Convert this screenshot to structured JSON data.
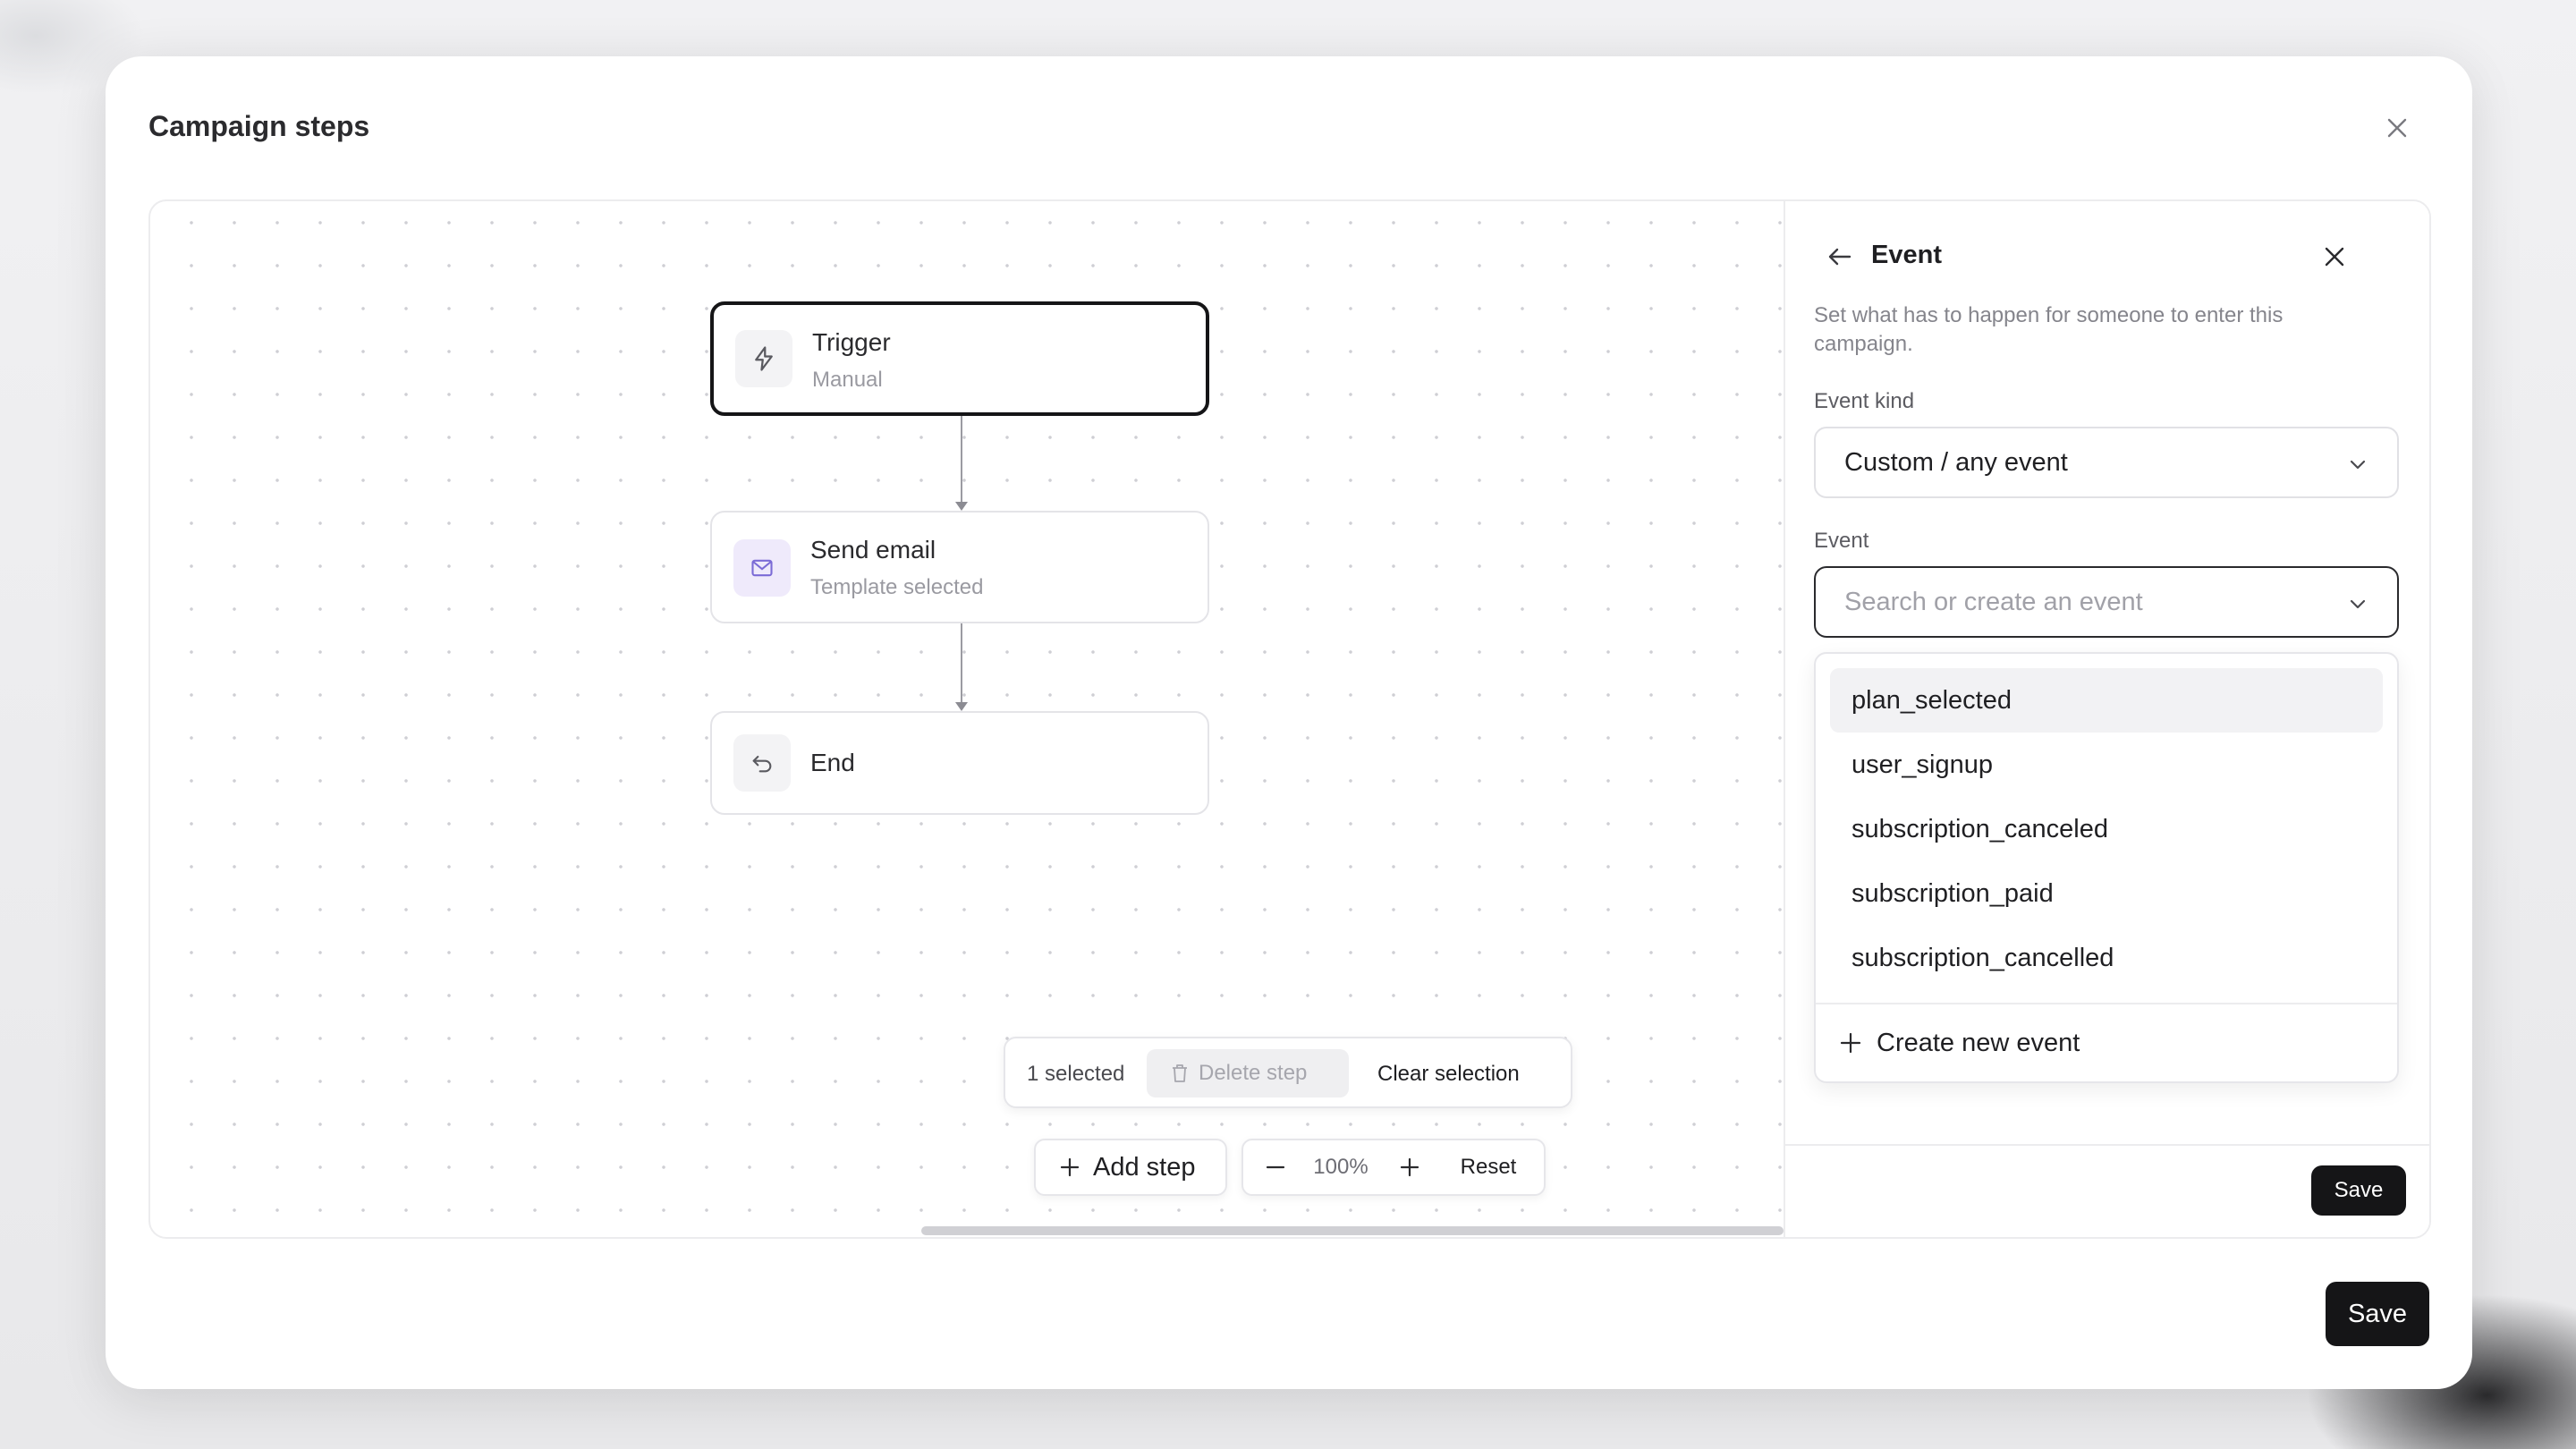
{
  "modal": {
    "title": "Campaign steps",
    "save_label": "Save"
  },
  "nodes": [
    {
      "title": "Trigger",
      "subtitle": "Manual",
      "icon": "lightning-icon",
      "selected": true
    },
    {
      "title": "Send email",
      "subtitle": "Template selected",
      "icon": "mail-icon",
      "selected": false
    },
    {
      "title": "End",
      "subtitle": "",
      "icon": "return-icon",
      "selected": false
    }
  ],
  "selection_bar": {
    "count_label": "1 selected",
    "delete_label": "Delete step",
    "clear_label": "Clear selection"
  },
  "toolbar": {
    "add_step_label": "Add step",
    "zoom_value": "100%",
    "reset_label": "Reset"
  },
  "panel": {
    "title": "Event",
    "description": "Set what has to happen for someone to enter this campaign.",
    "event_kind": {
      "label": "Event kind",
      "value": "Custom / any event"
    },
    "event": {
      "label": "Event",
      "placeholder": "Search or create an event",
      "options": [
        "plan_selected",
        "user_signup",
        "subscription_canceled",
        "subscription_paid",
        "subscription_cancelled"
      ],
      "highlighted_index": 0,
      "create_label": "Create new event"
    },
    "save_label": "Save"
  },
  "colors": {
    "primary": "#151517",
    "mail_icon_bg": "#efeafb",
    "mail_icon": "#7b6bd6"
  }
}
